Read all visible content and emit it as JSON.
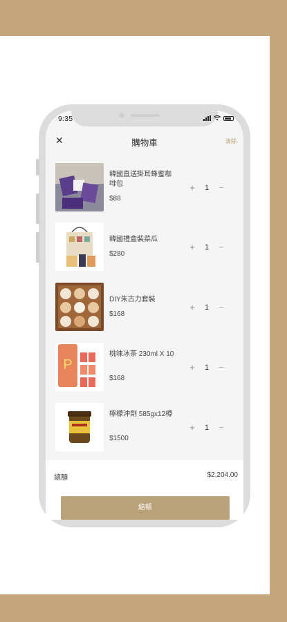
{
  "status_bar": {
    "time": "9:35"
  },
  "header": {
    "title": "購物車",
    "clear_label": "清除"
  },
  "cart": {
    "items": [
      {
        "name": "韓國直送掛耳蜂蜜咖啡包",
        "price": "$88",
        "qty": "1"
      },
      {
        "name": "韓國禮盒裝菜瓜",
        "price": "$280",
        "qty": "1"
      },
      {
        "name": "DIY朱古力套裝",
        "price": "$168",
        "qty": "1"
      },
      {
        "name": "桃味冰茶 230ml X 10",
        "price": "$168",
        "qty": "1"
      },
      {
        "name": "檸檬沖劑 585gx12樽",
        "price": "$1500",
        "qty": "1"
      }
    ],
    "plus_symbol": "+",
    "minus_symbol": "−"
  },
  "footer": {
    "total_label": "總額",
    "total_value": "$2,204.00",
    "checkout_label": "結賬"
  },
  "colors": {
    "accent": "#b9a27a",
    "frame": "#c4a67a"
  }
}
